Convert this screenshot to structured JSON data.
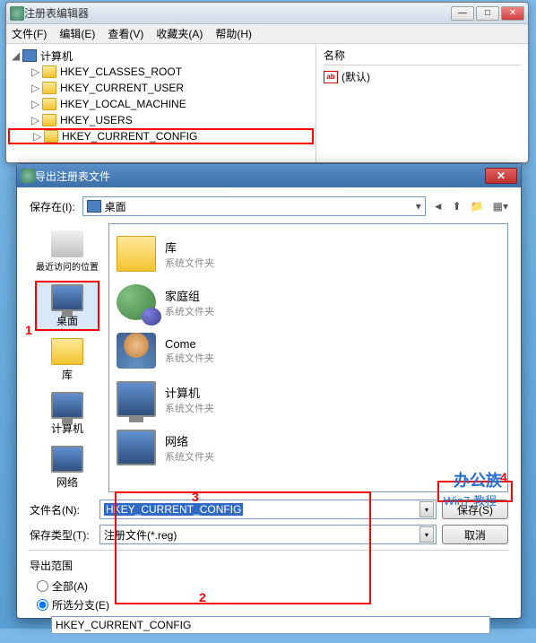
{
  "regedit": {
    "title": "注册表编辑器",
    "menu": {
      "file": "文件(F)",
      "edit": "编辑(E)",
      "view": "查看(V)",
      "favorites": "收藏夹(A)",
      "help": "帮助(H)"
    },
    "tree": {
      "root": "计算机",
      "keys": [
        "HKEY_CLASSES_ROOT",
        "HKEY_CURRENT_USER",
        "HKEY_LOCAL_MACHINE",
        "HKEY_USERS",
        "HKEY_CURRENT_CONFIG"
      ]
    },
    "right": {
      "col_name": "名称",
      "default_value": "(默认)"
    }
  },
  "export": {
    "title": "导出注册表文件",
    "save_in_label": "保存在(I):",
    "save_in_value": "桌面",
    "places": {
      "recent": "最近访问的位置",
      "desktop": "桌面",
      "libraries": "库",
      "computer": "计算机",
      "network": "网络"
    },
    "folder_type": "系统文件夹",
    "list": {
      "lib": "库",
      "homegroup": "家庭组",
      "user": "Come",
      "computer": "计算机",
      "network": "网络"
    },
    "fields": {
      "filename_label": "文件名(N):",
      "filename_value": "HKEY_CURRENT_CONFIG",
      "filetype_label": "保存类型(T):",
      "filetype_value": "注册文件(*.reg)"
    },
    "buttons": {
      "save": "保存(S)",
      "cancel": "取消"
    },
    "range": {
      "title": "导出范围",
      "all": "全部(A)",
      "selected": "所选分支(E)",
      "branch_value": "HKEY_CURRENT_CONFIG"
    }
  },
  "annotations": {
    "n1": "1",
    "n2": "2",
    "n3": "3",
    "n4": "4"
  },
  "watermark": {
    "brand": "办公族",
    "sub": "Win7 教程"
  }
}
